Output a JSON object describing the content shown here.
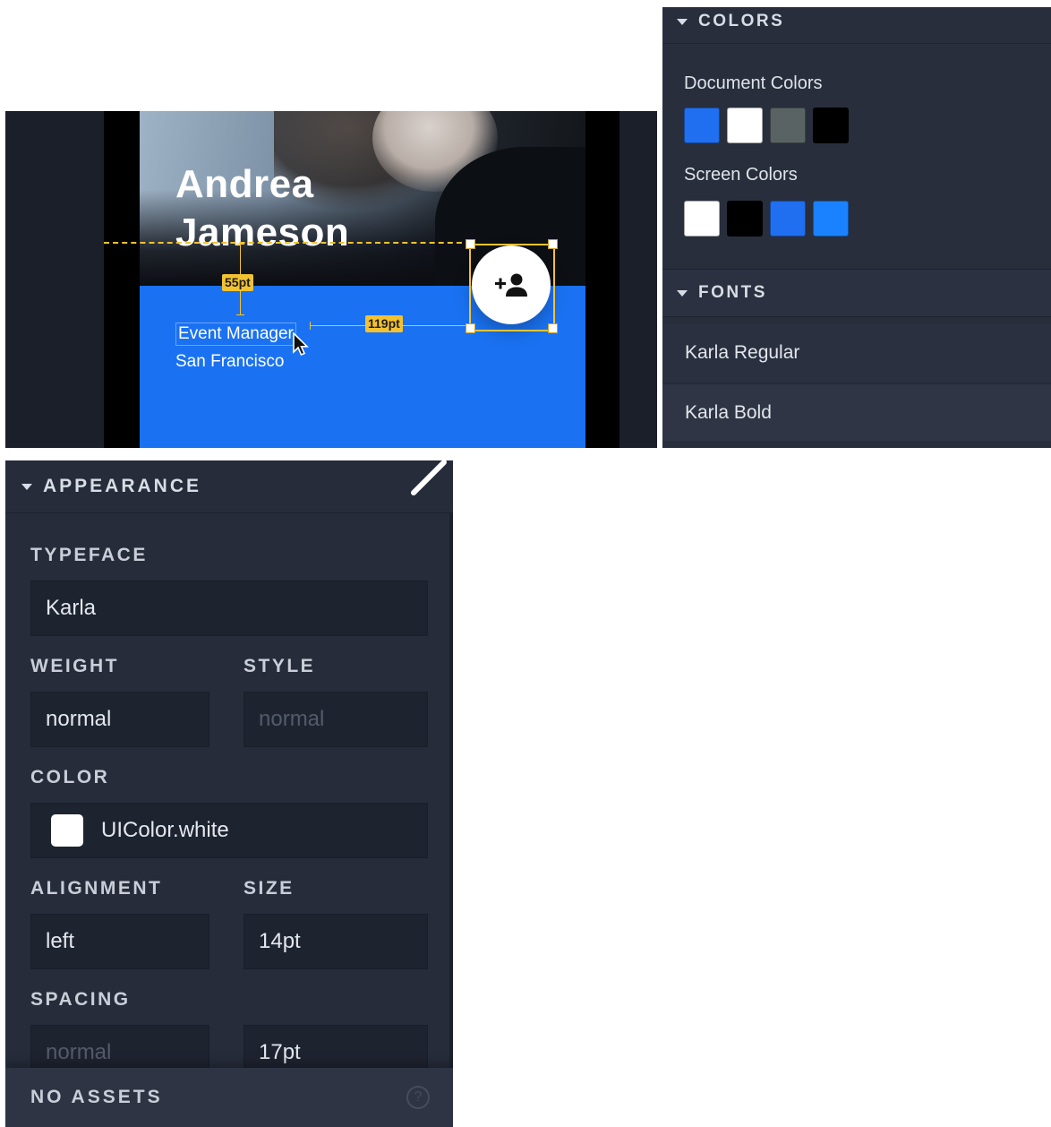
{
  "preview": {
    "name_line_1": "Andrea",
    "name_line_2": "Jameson",
    "job_title": "Event Manager",
    "location": "San Francisco",
    "measure_vertical": "55pt",
    "measure_horizontal": "119pt",
    "fab_icon": "add-person-icon",
    "colors": {
      "accent_blue": "#1a72f2",
      "guide": "#f3c230"
    }
  },
  "assets_panel": {
    "colors_heading": "COLORS",
    "document_colors_label": "Document Colors",
    "document_swatches": [
      "#1f6ff0",
      "#ffffff",
      "#5a6363",
      "#000000"
    ],
    "screen_colors_label": "Screen Colors",
    "screen_swatches": [
      "#ffffff",
      "#000000",
      "#1f6ff0",
      "#1a82ff"
    ],
    "fonts_heading": "FONTS",
    "fonts": [
      "Karla Regular",
      "Karla Bold"
    ]
  },
  "inspector": {
    "section_heading": "APPEARANCE",
    "typeface_label": "TYPEFACE",
    "typeface_value": "Karla",
    "weight_label": "WEIGHT",
    "weight_value": "normal",
    "style_label": "STYLE",
    "style_placeholder": "normal",
    "color_label": "COLOR",
    "color_value": "UIColor.white",
    "alignment_label": "ALIGNMENT",
    "alignment_value": "left",
    "size_label": "SIZE",
    "size_value": "14pt",
    "spacing_label": "SPACING",
    "spacing_placeholder": "normal",
    "spacing_value": "17pt",
    "footer_label": "NO ASSETS",
    "help_glyph": "?"
  }
}
